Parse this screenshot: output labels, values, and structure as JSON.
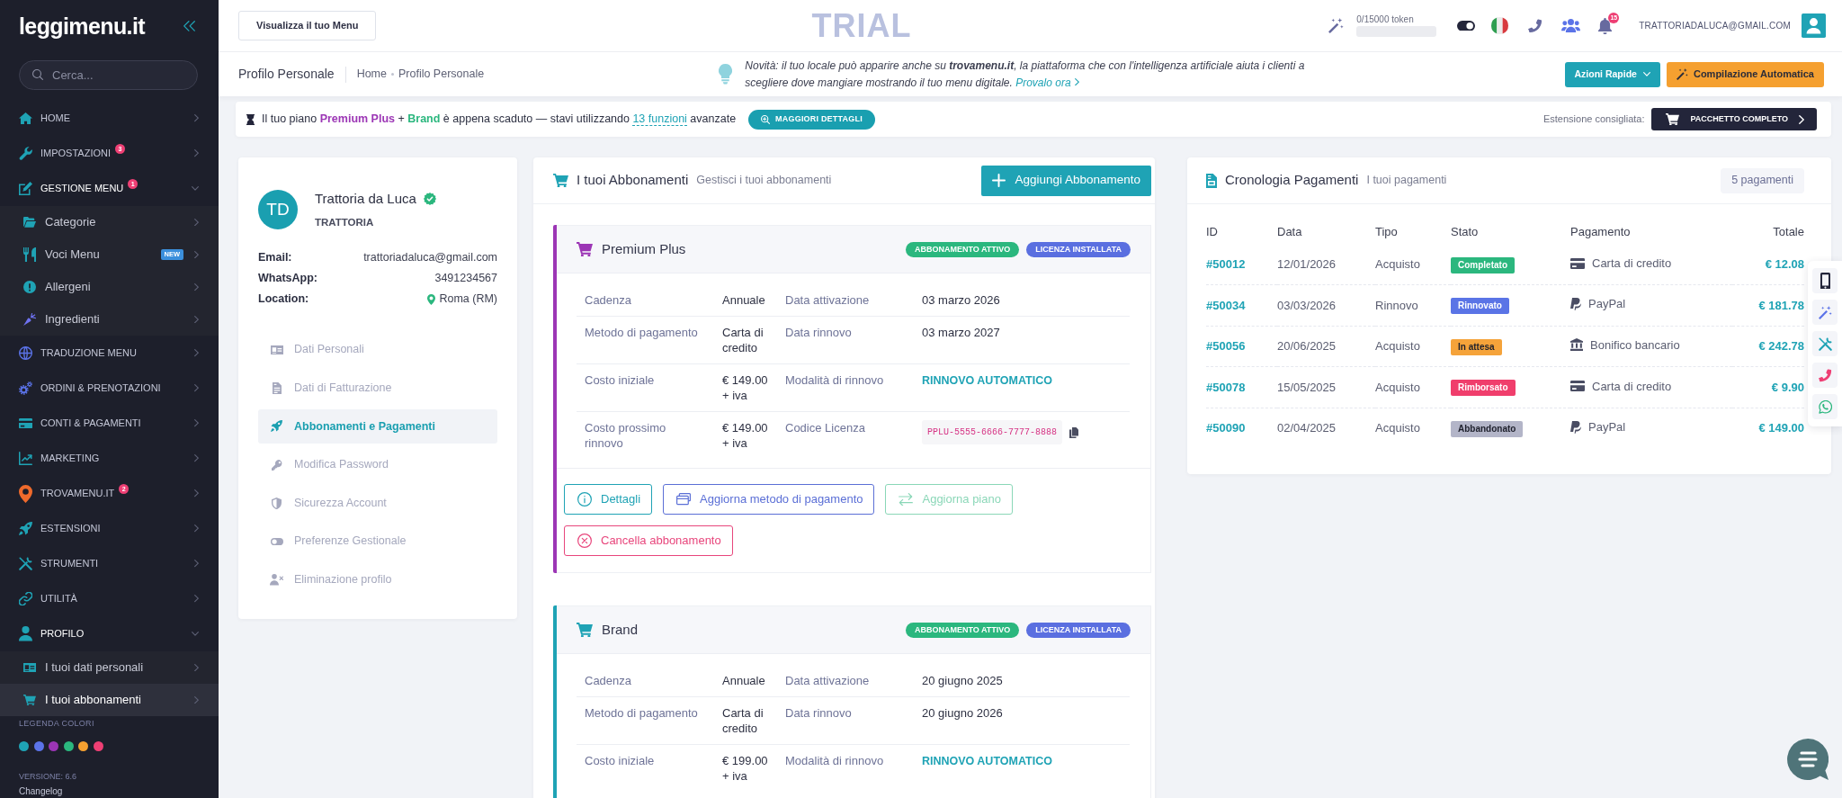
{
  "sidebar": {
    "logo": "leggimenu.it",
    "search": {
      "placeholder": "Cerca..."
    },
    "items": [
      {
        "label": "HOME",
        "expanded": false,
        "selected": false
      },
      {
        "label": "IMPOSTAZIONI",
        "badge": "3",
        "expanded": false,
        "selected": false
      },
      {
        "label": "GESTIONE MENU",
        "badge": "1",
        "expanded": true,
        "selected": false,
        "children": [
          {
            "label": "Categorie",
            "selected": false
          },
          {
            "label": "Voci Menu",
            "tag": "NEW",
            "selected": false
          },
          {
            "label": "Allergeni",
            "selected": false
          },
          {
            "label": "Ingredienti",
            "selected": false
          }
        ]
      },
      {
        "label": "TRADUZIONE MENU",
        "expanded": false,
        "selected": false
      },
      {
        "label": "ORDINI & PRENOTAZIONI",
        "expanded": false,
        "selected": false
      },
      {
        "label": "CONTI & PAGAMENTI",
        "expanded": false,
        "selected": false
      },
      {
        "label": "MARKETING",
        "expanded": false,
        "selected": false
      },
      {
        "label": "TROVAMENU.IT",
        "badge": "2",
        "expanded": false,
        "selected": false
      },
      {
        "label": "ESTENSIONI",
        "expanded": false,
        "selected": false
      },
      {
        "label": "STRUMENTI",
        "expanded": false,
        "selected": false
      },
      {
        "label": "UTILITÀ",
        "expanded": false,
        "selected": false
      },
      {
        "label": "PROFILO",
        "expanded": true,
        "selected": false,
        "children": [
          {
            "label": "I tuoi dati personali",
            "selected": false
          },
          {
            "label": "I tuoi abbonamenti",
            "selected": true
          }
        ]
      }
    ],
    "legend": {
      "title": "LEGENDA COLORI",
      "colors": [
        {
          "color": "#1fa3b5"
        },
        {
          "color": "#5b73e8"
        },
        {
          "color": "#9b35b5"
        },
        {
          "color": "#2bb77e"
        },
        {
          "color": "#f5a030"
        },
        {
          "color": "#ee3f74"
        }
      ]
    },
    "version": "VERSIONE: 6.6",
    "changelog": "Changelog"
  },
  "topbar": {
    "view_menu_button": "Visualizza il tuo Menu",
    "trial_label": "TRIAL",
    "tokens": {
      "label": "0/15000 token"
    },
    "notifications": "15",
    "user_email": "TRATTORIADALUCA@GMAIL.COM"
  },
  "page_header": {
    "title": "Profilo Personale",
    "breadcrumb": [
      "Home",
      "Profilo Personale"
    ],
    "news": "Novità: il tuo locale può apparire anche su **trovamenu.it**, la piattaforma che con l'intelligenza artificiale aiuta i clienti a scegliere dove mangiare mostrando il tuo menu digitale.",
    "news_link": "Provalo ora",
    "quick_actions_button": "Azioni Rapide",
    "auto_fill_button": "Compilazione Automatica"
  },
  "plan_alert": {
    "message": "Il tuo piano **Premium Plus** + **Brand** è appena scaduto — stavi utilizzando",
    "features_link": "13 funzioni",
    "message_end": "avanzate",
    "details_button": "MAGGIORI DETTAGLI",
    "suggestion_label": "Estensione consigliata:",
    "suggestion_button": "PACCHETTO COMPLETO"
  },
  "profile": {
    "initials": "TD",
    "name": "Trattoria da Luca",
    "verified": true,
    "type": "TRATTORIA",
    "fields": [
      {
        "label": "Email:",
        "value": "trattoriadaluca@gmail.com",
        "kind": "text"
      },
      {
        "label": "WhatsApp:",
        "value": "3491234567",
        "kind": "text"
      },
      {
        "label": "Location:",
        "value": "Roma (RM)",
        "kind": "location"
      }
    ],
    "menu": [
      {
        "label": "Dati Personali",
        "selected": false
      },
      {
        "label": "Dati di Fatturazione",
        "selected": false
      },
      {
        "label": "Abbonamenti e Pagamenti",
        "selected": true
      },
      {
        "label": "Modifica Password",
        "selected": false
      },
      {
        "label": "Sicurezza Account",
        "selected": false
      },
      {
        "label": "Preferenze Gestionale",
        "selected": false
      },
      {
        "label": "Eliminazione profilo",
        "selected": false
      }
    ]
  },
  "subscriptions": {
    "title": "I tuoi Abbonamenti",
    "subtitle": "Gestisci i tuoi abbonamenti",
    "add_button": "Aggiungi Abbonamento",
    "items": [
      {
        "name": "Premium Plus",
        "color": "#9c36b5",
        "badges": [
          {
            "label": "ABBONAMENTO ATTIVO",
            "color": "#2bb77e"
          },
          {
            "label": "LICENZA INSTALLATA",
            "color": "#5a6fe0"
          }
        ],
        "details": [
          {
            "label": "Cadenza",
            "value": "Annuale",
            "kind": "text"
          },
          {
            "label": "Data attivazione",
            "value": "03 marzo 2026",
            "kind": "text"
          },
          {
            "label": "Metodo di pagamento",
            "value": "Carta di credito",
            "kind": "text"
          },
          {
            "label": "Data rinnovo",
            "value": "03 marzo 2027",
            "kind": "text"
          },
          {
            "label": "Costo iniziale",
            "value": "€ 149.00 + iva",
            "kind": "text"
          },
          {
            "label": "Modalità di rinnovo",
            "value": "RINNOVO AUTOMATICO",
            "kind": "status"
          },
          {
            "label": "Costo prossimo rinnovo",
            "value": "€ 149.00 + iva",
            "kind": "text"
          },
          {
            "label": "Codice Licenza",
            "value": "PPLU-5555-6666-7777-8888",
            "kind": "code"
          }
        ],
        "actions": [
          {
            "label": "Dettagli",
            "kind": "details",
            "disabled": false
          },
          {
            "label": "Aggiorna metodo di pagamento",
            "kind": "payment_method",
            "disabled": false
          },
          {
            "label": "Aggiorna piano",
            "kind": "change_plan",
            "disabled": true
          },
          {
            "label": "Cancella abbonamento",
            "kind": "cancel",
            "disabled": false
          }
        ]
      },
      {
        "name": "Brand",
        "color": "#1fa3b5",
        "badges": [
          {
            "label": "ABBONAMENTO ATTIVO",
            "color": "#2bb77e"
          },
          {
            "label": "LICENZA INSTALLATA",
            "color": "#5a6fe0"
          }
        ],
        "details": [
          {
            "label": "Cadenza",
            "value": "Annuale",
            "kind": "text"
          },
          {
            "label": "Data attivazione",
            "value": "20 giugno 2025",
            "kind": "text"
          },
          {
            "label": "Metodo di pagamento",
            "value": "Carta di credito",
            "kind": "text"
          },
          {
            "label": "Data rinnovo",
            "value": "20 giugno 2026",
            "kind": "text"
          },
          {
            "label": "Costo iniziale",
            "value": "€ 199.00 + iva",
            "kind": "text"
          },
          {
            "label": "Modalità di rinnovo",
            "value": "RINNOVO AUTOMATICO",
            "kind": "status"
          }
        ]
      }
    ]
  },
  "payments": {
    "title": "Cronologia Pagamenti",
    "subtitle": "I tuoi pagamenti",
    "count": "5 pagamenti",
    "columns": [
      "ID",
      "Data",
      "Tipo",
      "Stato",
      "Pagamento",
      "Totale"
    ],
    "rows": [
      {
        "id": "#50012",
        "date": "12/01/2026",
        "type": "Acquisto",
        "status": {
          "label": "Completato",
          "color": "#2bb77e"
        },
        "payment": {
          "kind": "card",
          "label": "Carta di credito"
        },
        "total": "€ 12.08"
      },
      {
        "id": "#50034",
        "date": "03/03/2026",
        "type": "Rinnovo",
        "status": {
          "label": "Rinnovato",
          "color": "#5a74e6"
        },
        "payment": {
          "kind": "paypal",
          "label": "PayPal"
        },
        "total": "€ 181.78"
      },
      {
        "id": "#50056",
        "date": "20/06/2025",
        "type": "Acquisto",
        "status": {
          "label": "In attesa",
          "color": "#f5a33a"
        },
        "payment": {
          "kind": "bank",
          "label": "Bonifico bancario"
        },
        "total": "€ 242.78"
      },
      {
        "id": "#50078",
        "date": "15/05/2025",
        "type": "Acquisto",
        "status": {
          "label": "Rimborsato",
          "color": "#f03e6c"
        },
        "payment": {
          "kind": "card",
          "label": "Carta di credito"
        },
        "total": "€ 9.90"
      },
      {
        "id": "#50090",
        "date": "02/04/2025",
        "type": "Acquisto",
        "status": {
          "label": "Abbandonato",
          "color": "#b3b5c8"
        },
        "payment": {
          "kind": "paypal",
          "label": "PayPal"
        },
        "total": "€ 149.00"
      }
    ]
  }
}
